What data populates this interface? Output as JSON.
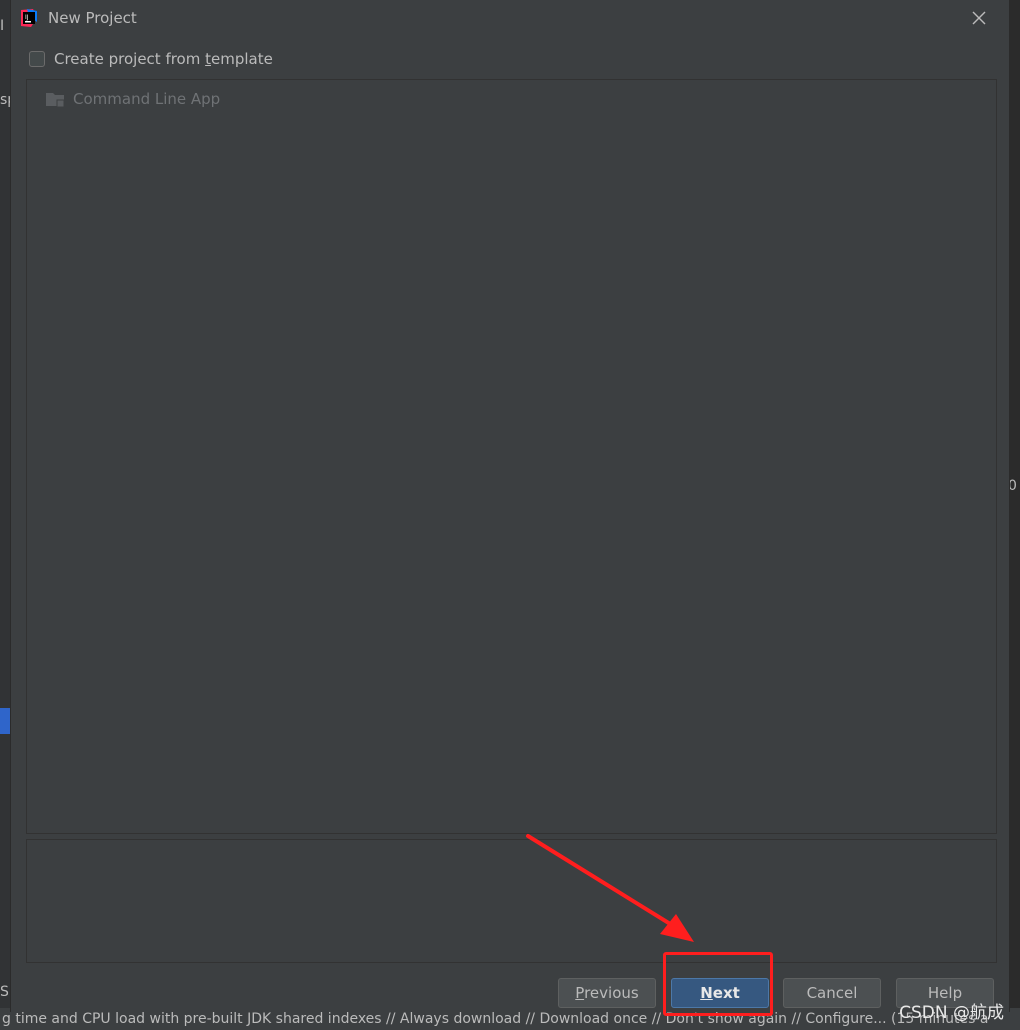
{
  "dialog": {
    "title": "New Project",
    "checkbox_label_before": "Create project from ",
    "checkbox_label_underlined": "t",
    "checkbox_label_after": "emplate",
    "checkbox_checked": false
  },
  "templates": {
    "items": [
      {
        "label": "Command Line App",
        "icon": "folder-icon"
      }
    ]
  },
  "buttons": {
    "previous_u": "P",
    "previous_rest": "revious",
    "next_u": "N",
    "next_rest": "ext",
    "cancel": "Cancel",
    "help": "Help"
  },
  "background": {
    "left_frag_1": "I",
    "left_frag_2": "sp",
    "left_frag_3": "S",
    "right_frag_1": "0",
    "status_text": "g time and CPU load with pre-built JDK shared indexes // Always download // Download once // Don't show again // Configure... (15 minutes a"
  },
  "watermark": "CSDN @航成",
  "colors": {
    "dialog_bg": "#3c3f41",
    "primary_button": "#365880",
    "annotation": "#ff1e1e"
  }
}
